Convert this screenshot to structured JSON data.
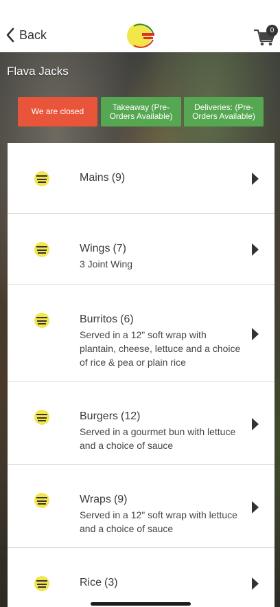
{
  "nav": {
    "back_label": "Back",
    "cart_count": "0"
  },
  "venue": {
    "name": "Flava Jacks"
  },
  "status": {
    "closed": "We are closed",
    "takeaway": "Takeaway (Pre-Orders Available)",
    "delivery": "Deliveries: (Pre-Orders Available)"
  },
  "colors": {
    "closed": "#e8553a",
    "open": "#55a751"
  },
  "categories": [
    {
      "name": "Mains",
      "count": "(9)",
      "desc": ""
    },
    {
      "name": "Wings",
      "count": "(7)",
      "desc": "3 Joint Wing"
    },
    {
      "name": "Burritos",
      "count": "(6)",
      "desc": "Served in a 12\" soft wrap with plantain, cheese, lettuce and a choice of rice & pea or plain rice"
    },
    {
      "name": "Burgers",
      "count": "(12)",
      "desc": "Served in a gourmet bun with lettuce and a choice of sauce"
    },
    {
      "name": "Wraps",
      "count": "(9)",
      "desc": "Served in a 12\" soft wrap with lettuce and a choice of sauce"
    },
    {
      "name": "Rice",
      "count": "(3)",
      "desc": ""
    }
  ]
}
